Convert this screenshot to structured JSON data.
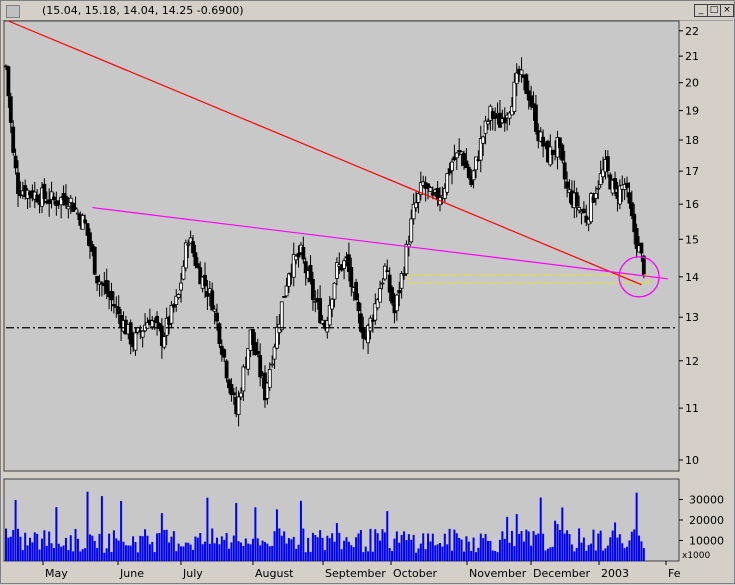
{
  "window": {
    "title": "(15.04, 15.18, 14.04, 14.25 -0.6900)",
    "minimize_label": "_",
    "restore_label": "□",
    "close_label": "×"
  },
  "colors": {
    "panel_bg": "#c8c8c8",
    "candle": "#000000",
    "trend_long": "#ff0000",
    "trend_short": "#ff00ff",
    "support_band": "#e8e800",
    "volume_bar": "#0000ff",
    "marker_circle": "#ff00ff"
  },
  "chart_data": [
    {
      "type": "candlestick",
      "title": "",
      "y_scale": "log",
      "ylim": [
        9.8,
        22.4
      ],
      "y_ticks": [
        22,
        21,
        20,
        19,
        18,
        17,
        16,
        15,
        14,
        13,
        12,
        11,
        10
      ],
      "x_labels": [
        "May",
        "June",
        "July",
        "August",
        "September",
        "October",
        "November",
        "December",
        "2003",
        "Fe"
      ],
      "price_path": [
        [
          0,
          20.6
        ],
        [
          3,
          17.5
        ],
        [
          5,
          16.5
        ],
        [
          12,
          16.3
        ],
        [
          20,
          16.1
        ],
        [
          26,
          16.2
        ],
        [
          33,
          15.4
        ],
        [
          38,
          14.0
        ],
        [
          45,
          13.3
        ],
        [
          53,
          12.4
        ],
        [
          60,
          13.0
        ],
        [
          65,
          12.5
        ],
        [
          72,
          13.5
        ],
        [
          76,
          15.1
        ],
        [
          80,
          14.2
        ],
        [
          86,
          13.4
        ],
        [
          92,
          11.8
        ],
        [
          96,
          10.9
        ],
        [
          102,
          12.6
        ],
        [
          108,
          11.3
        ],
        [
          113,
          12.7
        ],
        [
          118,
          14.2
        ],
        [
          123,
          14.6
        ],
        [
          128,
          13.5
        ],
        [
          133,
          12.8
        ],
        [
          138,
          14.2
        ],
        [
          142,
          14.4
        ],
        [
          146,
          13.2
        ],
        [
          150,
          12.5
        ],
        [
          154,
          13.3
        ],
        [
          158,
          14.2
        ],
        [
          162,
          13.1
        ],
        [
          166,
          14.3
        ],
        [
          170,
          15.8
        ],
        [
          174,
          16.6
        ],
        [
          178,
          16.1
        ],
        [
          182,
          16.4
        ],
        [
          186,
          17.3
        ],
        [
          190,
          17.6
        ],
        [
          194,
          16.6
        ],
        [
          198,
          17.9
        ],
        [
          202,
          18.9
        ],
        [
          206,
          18.6
        ],
        [
          210,
          19.2
        ],
        [
          214,
          20.3
        ],
        [
          218,
          19.6
        ],
        [
          222,
          18.2
        ],
        [
          226,
          17.5
        ],
        [
          230,
          17.8
        ],
        [
          234,
          16.4
        ],
        [
          238,
          16.0
        ],
        [
          242,
          15.6
        ],
        [
          246,
          16.5
        ],
        [
          250,
          17.1
        ],
        [
          254,
          16.3
        ],
        [
          258,
          16.6
        ],
        [
          261,
          15.5
        ],
        [
          264,
          14.7
        ],
        [
          266,
          14.25
        ]
      ],
      "trendlines": [
        {
          "from": [
            1,
            22.4
          ],
          "to": [
            265,
            13.8
          ],
          "color_key": "trend_long"
        },
        {
          "from": [
            36,
            15.9
          ],
          "to": [
            276,
            13.95
          ],
          "color_key": "trend_short"
        },
        {
          "from": [
            0,
            12.75
          ],
          "to": [
            280,
            12.75
          ],
          "style": "dash-dot",
          "color_key": "candle"
        }
      ],
      "support_band": {
        "x": [
          168,
          268
        ],
        "y": [
          13.85,
          14.05
        ]
      },
      "marker": {
        "x": 264,
        "y": 14.0
      }
    },
    {
      "type": "bar",
      "title": "",
      "ylim": [
        0,
        40000
      ],
      "y_ticks": [
        30000,
        20000,
        10000
      ],
      "y_unit_label": "x1000",
      "series": [
        {
          "name": "",
          "values": []
        }
      ]
    }
  ]
}
